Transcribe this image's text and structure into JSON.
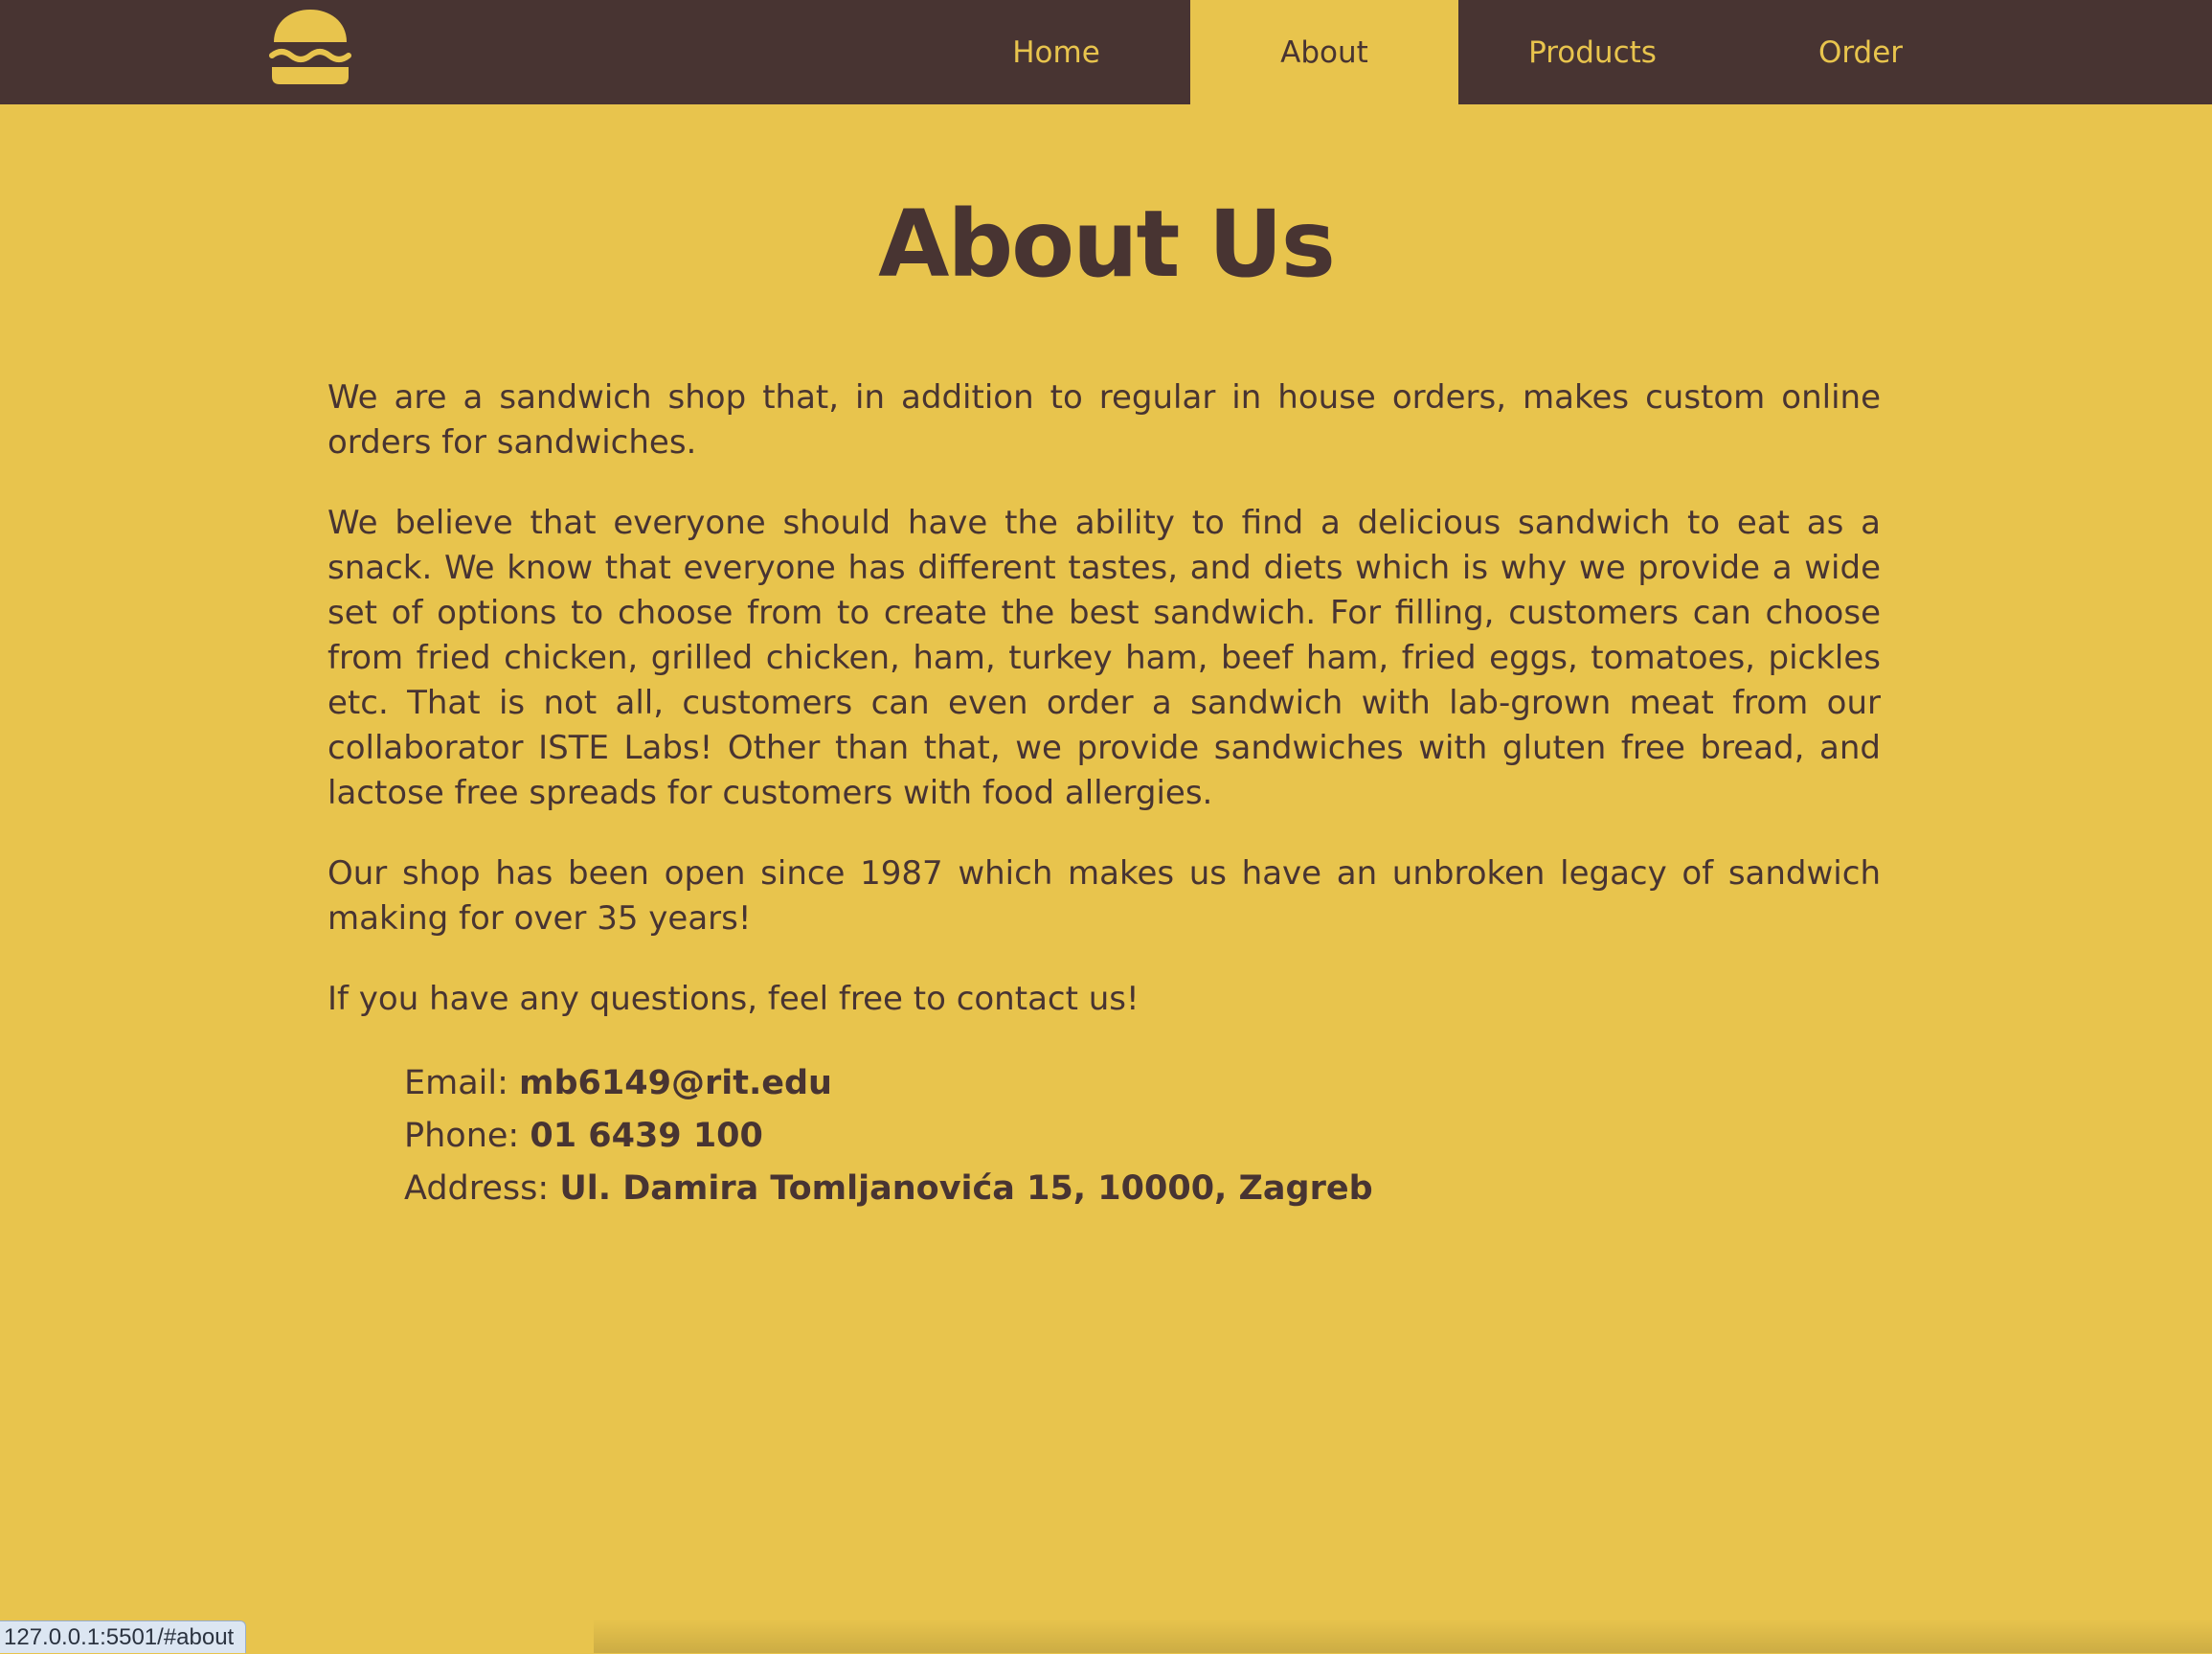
{
  "colors": {
    "background": "#E8C44D",
    "nav_background": "#483432",
    "text": "#483432"
  },
  "logo": {
    "icon": "burger-icon"
  },
  "nav": {
    "items": [
      {
        "label": "Home",
        "active": false
      },
      {
        "label": "About",
        "active": true
      },
      {
        "label": "Products",
        "active": false
      },
      {
        "label": "Order",
        "active": false
      }
    ]
  },
  "main": {
    "title": "About Us",
    "paragraphs": [
      "We are a sandwich shop that, in addition to regular in house orders, makes custom online orders for sandwiches.",
      "We believe that everyone should have the ability to find a delicious sandwich to eat as a snack. We know that everyone has different tastes, and diets which is why we provide a wide set of options to choose from to create the best sandwich. For filling, customers can choose from fried chicken, grilled chicken, ham, turkey ham, beef ham, fried eggs, tomatoes, pickles etc. That is not all, customers can even order a sandwich with lab-grown meat from our collaborator ISTE Labs! Other than that, we provide sandwiches with gluten free bread, and lactose free spreads for customers with food allergies.",
      "Our shop has been open since 1987 which makes us have an unbroken legacy of sandwich making for over 35 years!",
      "If you have any questions, feel free to contact us!"
    ],
    "contact": {
      "email_label": "Email:",
      "email_value": "mb6149@rit.edu",
      "phone_label": "Phone:",
      "phone_value": "01 6439 100",
      "address_label": "Address:",
      "address_value": "Ul. Damira Tomljanovića 15, 10000, Zagreb"
    }
  },
  "status_bar": {
    "url": "127.0.0.1:5501/#about"
  }
}
